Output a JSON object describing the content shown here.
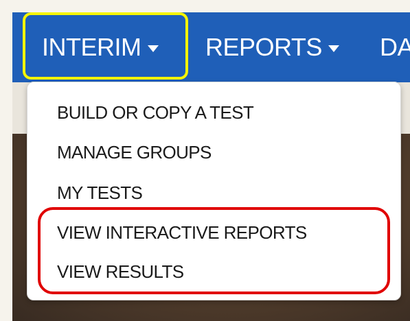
{
  "navbar": {
    "items": [
      {
        "label": "INTERIM",
        "icon": "caret-down-icon"
      },
      {
        "label": "REPORTS",
        "icon": "caret-down-icon"
      },
      {
        "label": "DA"
      }
    ]
  },
  "dropdown": {
    "items": [
      {
        "label": "BUILD OR COPY A TEST"
      },
      {
        "label": "MANAGE GROUPS"
      },
      {
        "label": "MY TESTS"
      },
      {
        "label": "VIEW INTERACTIVE REPORTS"
      },
      {
        "label": "VIEW RESULTS"
      }
    ]
  },
  "colors": {
    "navbar": "#1f5fb8",
    "highlight_yellow": "#f5f500",
    "highlight_red": "#e00000"
  }
}
